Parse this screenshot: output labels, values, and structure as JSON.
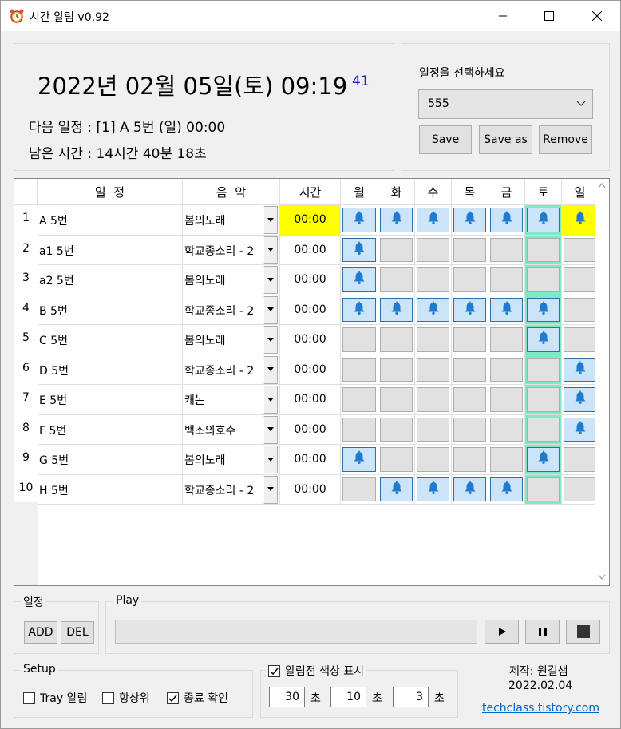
{
  "window": {
    "title": "시간 알림 v0.92"
  },
  "clock": {
    "datetime": "2022년 02월 05일(토) 09:19",
    "seconds": "41",
    "next_schedule": "다음 일정 : [1] A 5번 (일) 00:00",
    "remaining": "남은 시간 : 14시간 40분 18초"
  },
  "schedule_select": {
    "label": "일정을 선택하세요",
    "selected": "555",
    "save_label": "Save",
    "save_as_label": "Save as",
    "remove_label": "Remove"
  },
  "grid": {
    "headers": [
      "일  정",
      "음  악",
      "시간",
      "월",
      "화",
      "수",
      "목",
      "금",
      "토",
      "일"
    ],
    "rows": [
      {
        "num": "1",
        "name": "A 5번",
        "music": "봄의노래",
        "time": "00:00",
        "days": [
          true,
          true,
          true,
          true,
          true,
          true,
          true
        ]
      },
      {
        "num": "2",
        "name": "a1 5번",
        "music": "학교종소리 - 2",
        "time": "00:00",
        "days": [
          true,
          false,
          false,
          false,
          false,
          false,
          false
        ]
      },
      {
        "num": "3",
        "name": "a2 5번",
        "music": "봄의노래",
        "time": "00:00",
        "days": [
          true,
          false,
          false,
          false,
          false,
          false,
          false
        ]
      },
      {
        "num": "4",
        "name": "B 5번",
        "music": "학교종소리 - 2",
        "time": "00:00",
        "days": [
          true,
          true,
          true,
          true,
          true,
          true,
          false
        ]
      },
      {
        "num": "5",
        "name": "C 5번",
        "music": "봄의노래",
        "time": "00:00",
        "days": [
          false,
          false,
          false,
          false,
          false,
          true,
          false
        ]
      },
      {
        "num": "6",
        "name": "D 5번",
        "music": "학교종소리 - 2",
        "time": "00:00",
        "days": [
          false,
          false,
          false,
          false,
          false,
          false,
          true
        ]
      },
      {
        "num": "7",
        "name": "E 5번",
        "music": "캐논",
        "time": "00:00",
        "days": [
          false,
          false,
          false,
          false,
          false,
          false,
          true
        ]
      },
      {
        "num": "8",
        "name": "F 5번",
        "music": "백조의호수",
        "time": "00:00",
        "days": [
          false,
          false,
          false,
          false,
          false,
          false,
          true
        ]
      },
      {
        "num": "9",
        "name": "G 5번",
        "music": "봄의노래",
        "time": "00:00",
        "days": [
          true,
          false,
          false,
          false,
          false,
          true,
          false
        ]
      },
      {
        "num": "10",
        "name": "H 5번",
        "music": "학교종소리 - 2",
        "time": "00:00",
        "days": [
          false,
          true,
          true,
          true,
          true,
          false,
          false
        ]
      }
    ]
  },
  "schedule_group": {
    "title": "일정",
    "add_label": "ADD",
    "del_label": "DEL"
  },
  "play_group": {
    "title": "Play"
  },
  "setup_group": {
    "title": "Setup",
    "tray_label": "Tray 알림",
    "always_top_label": "항상위",
    "exit_confirm_label": "종료 확인",
    "tray_checked": false,
    "always_top_checked": false,
    "exit_confirm_checked": true
  },
  "alert_color": {
    "label": "알림전 색상 표시",
    "checked": true,
    "values": [
      "30",
      "10",
      "3"
    ],
    "unit": "초"
  },
  "credits": {
    "author": "제작: 원길샘",
    "date": "2022.02.04",
    "link": "techclass.tistory.com"
  },
  "colors": {
    "highlight_yellow": "#ffff00",
    "today_column": "#7fe8c4",
    "bell_blue": "#1f7bd1",
    "bell_button_on": "#cce4f7"
  }
}
